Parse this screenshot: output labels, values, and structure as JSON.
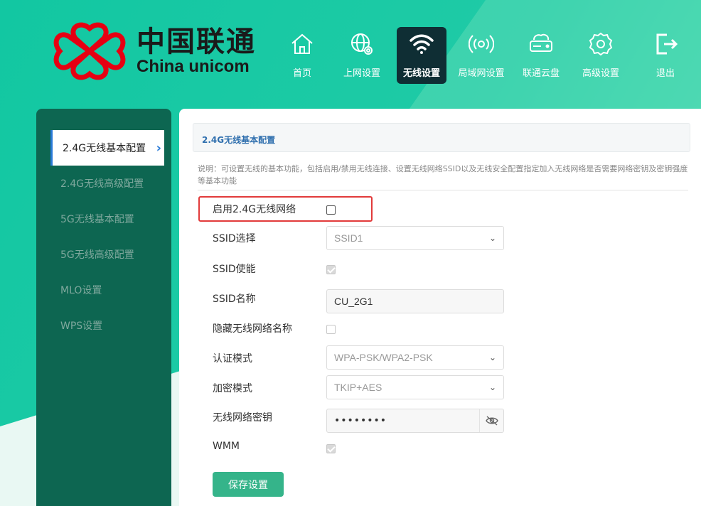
{
  "brand": {
    "cn": "中国联通",
    "en": "China unicom"
  },
  "nav": [
    {
      "label": "首页",
      "icon": "home-icon"
    },
    {
      "label": "上网设置",
      "icon": "globe-gear-icon"
    },
    {
      "label": "无线设置",
      "icon": "wifi-icon",
      "active": true
    },
    {
      "label": "局域网设置",
      "icon": "broadcast-icon"
    },
    {
      "label": "联通云盘",
      "icon": "cloud-drive-icon"
    },
    {
      "label": "高级设置",
      "icon": "settings-icon"
    },
    {
      "label": "退出",
      "icon": "logout-icon"
    }
  ],
  "sidebar": {
    "items": [
      {
        "label": "2.4G无线基本配置",
        "active": true
      },
      {
        "label": "2.4G无线高级配置"
      },
      {
        "label": "5G无线基本配置"
      },
      {
        "label": "5G无线高级配置"
      },
      {
        "label": "MLO设置"
      },
      {
        "label": "WPS设置"
      }
    ]
  },
  "main": {
    "title": "2.4G无线基本配置",
    "desc": "说明：可设置无线的基本功能，包括启用/禁用无线连接、设置无线网络SSID以及无线安全配置指定加入无线网络是否需要网络密钥及密钥强度等基本功能",
    "fields": {
      "enable_label": "启用2.4G无线网络",
      "enable_checked": false,
      "ssid_select_label": "SSID选择",
      "ssid_select_value": "SSID1",
      "ssid_enable_label": "SSID使能",
      "ssid_enable_checked": true,
      "ssid_name_label": "SSID名称",
      "ssid_name_value": "CU_2G1",
      "hide_ssid_label": "隐藏无线网络名称",
      "hide_ssid_checked": false,
      "auth_label": "认证模式",
      "auth_value": "WPA-PSK/WPA2-PSK",
      "encrypt_label": "加密模式",
      "encrypt_value": "TKIP+AES",
      "key_label": "无线网络密钥",
      "key_value": "••••••••",
      "wmm_label": "WMM",
      "wmm_checked": true
    },
    "save_label": "保存设置"
  },
  "colors": {
    "accent": "#35b48a",
    "sidebar": "#0d6651",
    "nav_active": "#0f2e34",
    "highlight": "#e23b3b"
  }
}
